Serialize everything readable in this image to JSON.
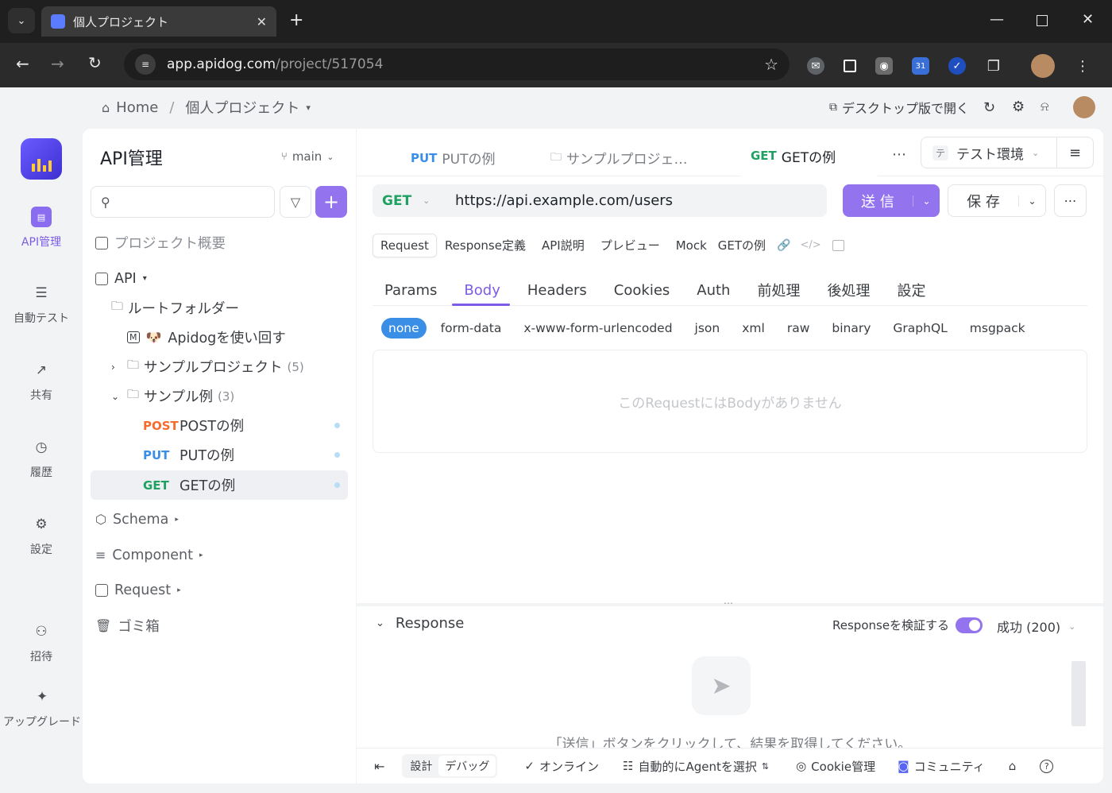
{
  "browser": {
    "tab_title": "個人プロジェクト",
    "url_domain": "app.apidog.com",
    "url_path": "/project/517054"
  },
  "header": {
    "home": "Home",
    "separator": "/",
    "project": "個人プロジェクト",
    "desktop_link": "デスクトップ版で開く"
  },
  "rail": {
    "items": [
      {
        "label": "API管理",
        "icon": "api-icon"
      },
      {
        "label": "自動テスト",
        "icon": "test-icon"
      },
      {
        "label": "共有",
        "icon": "share-icon"
      },
      {
        "label": "履歴",
        "icon": "history-icon"
      },
      {
        "label": "設定",
        "icon": "settings-icon"
      },
      {
        "label": "招待",
        "icon": "invite-icon"
      },
      {
        "label": "アップグレード",
        "icon": "sparkle-icon"
      }
    ]
  },
  "sidebar": {
    "title": "API管理",
    "branch": "main",
    "overview": "プロジェクト概要",
    "api": "API",
    "root_folder": "ルートフォルダー",
    "doc_item": "Apidogを使い回す",
    "folders": [
      {
        "name": "サンプルプロジェクト",
        "count": "(5)"
      },
      {
        "name": "サンプル例",
        "count": "(3)"
      }
    ],
    "endpoints": [
      {
        "method": "POST",
        "name": "POSTの例"
      },
      {
        "method": "PUT",
        "name": "PUTの例"
      },
      {
        "method": "GET",
        "name": "GETの例"
      }
    ],
    "schema": "Schema",
    "component": "Component",
    "request": "Request",
    "trash": "ゴミ箱"
  },
  "tabs": [
    {
      "method": "PUT",
      "name": "PUTの例"
    },
    {
      "method": "",
      "name": "サンプルプロジェ…"
    },
    {
      "method": "GET",
      "name": "GETの例"
    }
  ],
  "env": {
    "badge": "テ",
    "name": "テスト環境"
  },
  "request": {
    "method": "GET",
    "url": "https://api.example.com/users",
    "send": "送 信",
    "save": "保 存"
  },
  "segments": [
    "Request",
    "Response定義",
    "API説明",
    "プレビュー",
    "Mock"
  ],
  "segment_name": "GETの例",
  "subtabs": [
    "Params",
    "Body",
    "Headers",
    "Cookies",
    "Auth",
    "前処理",
    "後処理",
    "設定"
  ],
  "body_types": [
    "none",
    "form-data",
    "x-www-form-urlencoded",
    "json",
    "xml",
    "raw",
    "binary",
    "GraphQL",
    "msgpack"
  ],
  "body_empty": "このRequestにはBodyがありません",
  "response": {
    "title": "Response",
    "validate": "Responseを検証する",
    "status": "成功 (200)",
    "hint": "「送信」ボタンをクリックして、結果を取得してください。"
  },
  "footer": {
    "design": "設計",
    "debug": "デバッグ",
    "online": "オンライン",
    "agent": "自動的にAgentを選択",
    "cookie": "Cookie管理",
    "community": "コミュニティ"
  },
  "colors": {
    "accent": "#9373ee",
    "get": "#20a162",
    "put": "#3a8ee6",
    "post": "#f56c2d",
    "toggle": "#9373ee"
  }
}
